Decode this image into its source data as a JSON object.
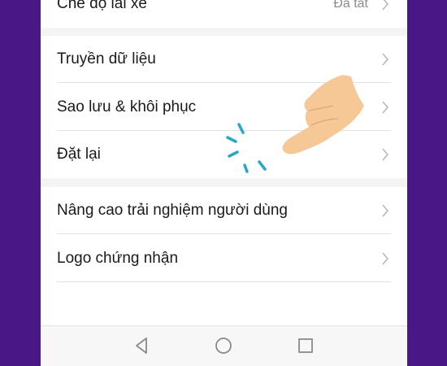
{
  "settings": {
    "items": [
      {
        "label": "Chế độ lái xe",
        "value": "Đã tắt"
      },
      {
        "label": "Truyền dữ liệu",
        "value": ""
      },
      {
        "label": "Sao lưu & khôi phục",
        "value": ""
      },
      {
        "label": "Đặt lại",
        "value": ""
      },
      {
        "label": "Nâng cao trải nghiệm người dùng",
        "value": ""
      },
      {
        "label": "Logo chứng nhận",
        "value": ""
      }
    ]
  },
  "navbar": {
    "buttons": [
      "back-icon",
      "home-icon",
      "recents-icon"
    ]
  },
  "colors": {
    "frame": "#4a1786",
    "tap_indicator": "#2aa7c6",
    "hand": "#f6c896"
  }
}
